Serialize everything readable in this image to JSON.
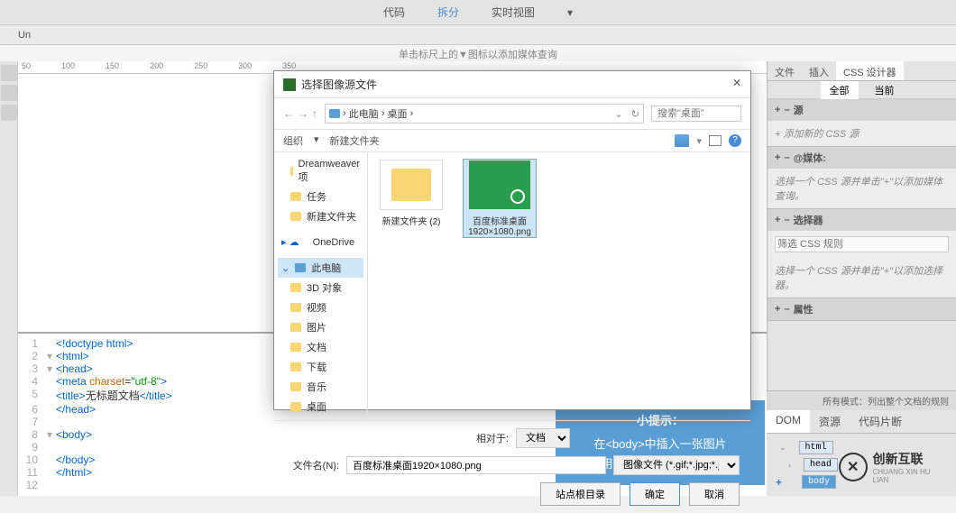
{
  "topMenu": {
    "code": "代码",
    "split": "拆分",
    "live": "实时视图"
  },
  "docTab": "Un",
  "hint": "单击标尺上的▼图标以添加媒体查询",
  "ruler": [
    "50",
    "100",
    "150",
    "200",
    "250",
    "300",
    "350"
  ],
  "code": {
    "l1": "<!doctype html>",
    "l2o": "<html>",
    "l2c": "</html>",
    "l3o": "<head>",
    "l3c": "</head>",
    "l4a": "<meta ",
    "l4b": "charset",
    "l4c": "=",
    "l4d": "\"utf-8\"",
    "l4e": ">",
    "l5o": "<title>",
    "l5t": "无标题文档",
    "l5c": "</title>",
    "l8o": "<body>",
    "l8c": "</body>"
  },
  "rightPanel": {
    "tabs": {
      "file": "文件",
      "insert": "插入",
      "css": "CSS 设计器"
    },
    "sub": {
      "all": "全部",
      "current": "当前"
    },
    "sources": {
      "title": "源",
      "placeholder": "+ 添加新的 CSS 源"
    },
    "media": {
      "title": "@媒体:",
      "hint": "选择一个 CSS 源并单击\"+\"以添加媒体查询。"
    },
    "selectors": {
      "title": "选择器",
      "placeholder": "筛选 CSS 规则",
      "hint": "选择一个 CSS 源并单击\"+\"以添加选择器。"
    },
    "props": {
      "title": "属性"
    }
  },
  "dom": {
    "hint": "所有模式：列出整个文档的规则",
    "tabs": {
      "dom": "DOM",
      "res": "资源",
      "snip": "代码片断"
    },
    "tags": {
      "html": "html",
      "head": "head",
      "body": "body"
    }
  },
  "dialog": {
    "title": "选择图像源文件",
    "breadcrumb": {
      "pc": "此电脑",
      "desktop": "桌面"
    },
    "searchPlaceholder": "搜索\"桌面\"",
    "toolbar": {
      "org": "组织",
      "newFolder": "新建文件夹"
    },
    "sidebar": {
      "dw": "Dreamweaver项",
      "tasks": "任务",
      "newFolder": "新建文件夹",
      "onedrive": "OneDrive",
      "thisPc": "此电脑",
      "obj3d": "3D 对象",
      "video": "视频",
      "pictures": "图片",
      "docs": "文档",
      "downloads": "下载",
      "music": "音乐",
      "desktop": "桌面"
    },
    "items": {
      "folder": "新建文件夹 (2)",
      "image": "百度标准桌面1920×1080.png"
    },
    "relativeTo": {
      "label": "相对于:",
      "value": "文档"
    },
    "filename": {
      "label": "文件名(N):",
      "value": "百度标准桌面1920×1080.png"
    },
    "filter": "图像文件 (*.gif;*.jpg;*.jpeg;*.png",
    "buttons": {
      "siteRoot": "站点根目录",
      "ok": "确定",
      "cancel": "取消"
    }
  },
  "tip": {
    "title": "小提示：",
    "line1": "在<body>中插入一张图片",
    "line2": "使用CSS设计器更改其尺寸"
  },
  "logo": {
    "text": "创新互联",
    "sub": "CHUANG XIN HU LIAN"
  }
}
